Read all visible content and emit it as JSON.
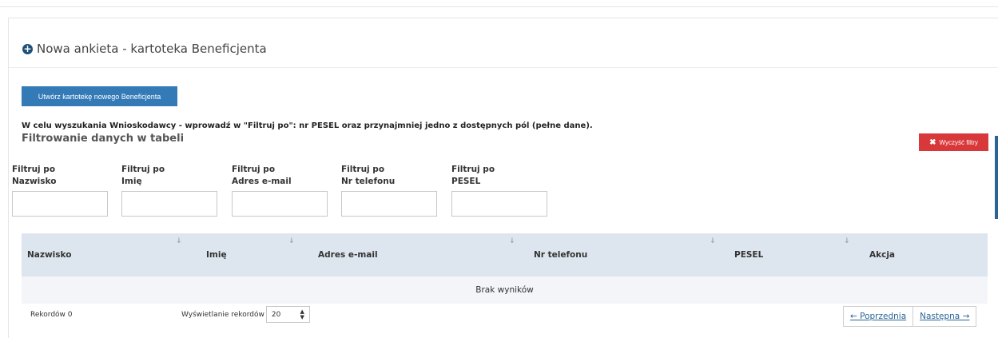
{
  "panel": {
    "title": "Nowa ankieta - kartoteka Beneficjenta",
    "icon": "plus-circle-icon"
  },
  "buttons": {
    "new_beneficiary": "Utwórz kartotekę nowego Beneficjenta",
    "clear_filters": "Wyczyść filtry"
  },
  "info_text": "W celu wyszukania Wnioskodawcy - wprowadź w \"Filtruj po\": nr PESEL oraz przynajmniej jedno z dostępnych pól (pełne dane).",
  "filter_title": "Filtrowanie danych w tabeli",
  "filters": [
    {
      "prefix": "Filtruj po",
      "field": "Nazwisko",
      "value": ""
    },
    {
      "prefix": "Filtruj po",
      "field": "Imię",
      "value": ""
    },
    {
      "prefix": "Filtruj po",
      "field": "Adres e-mail",
      "value": ""
    },
    {
      "prefix": "Filtruj po",
      "field": "Nr telefonu",
      "value": ""
    },
    {
      "prefix": "Filtruj po",
      "field": "PESEL",
      "value": ""
    }
  ],
  "table": {
    "columns": [
      "Nazwisko",
      "Imię",
      "Adres e-mail",
      "Nr telefonu",
      "PESEL",
      "Akcja"
    ],
    "empty_text": "Brak wyników"
  },
  "footer": {
    "records_text": "Rekordów 0",
    "display_label": "Wyświetlanie rekordów",
    "page_size": "20",
    "prev": "← Poprzednia",
    "next": "Następna →"
  },
  "colors": {
    "primary": "#337ab7",
    "danger": "#d9383a",
    "table_header": "#dde6ee"
  }
}
